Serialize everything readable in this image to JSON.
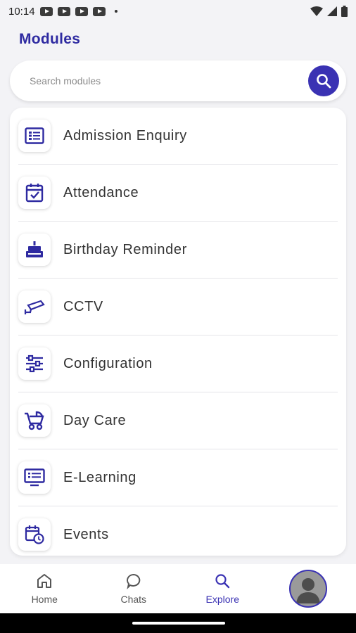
{
  "status_bar": {
    "time": "10:14",
    "notification_icons": [
      "youtube-icon",
      "youtube-icon",
      "youtube-icon",
      "youtube-icon"
    ]
  },
  "page": {
    "title": "Modules"
  },
  "search": {
    "placeholder": "Search modules"
  },
  "modules": [
    {
      "label": "Admission Enquiry",
      "icon": "form-list-icon"
    },
    {
      "label": "Attendance",
      "icon": "calendar-check-icon"
    },
    {
      "label": "Birthday Reminder",
      "icon": "cake-icon"
    },
    {
      "label": "CCTV",
      "icon": "cctv-camera-icon"
    },
    {
      "label": "Configuration",
      "icon": "sliders-icon"
    },
    {
      "label": "Day Care",
      "icon": "stroller-icon"
    },
    {
      "label": "E-Learning",
      "icon": "monitor-icon"
    },
    {
      "label": "Events",
      "icon": "calendar-clock-icon"
    }
  ],
  "bottom_nav": {
    "home": "Home",
    "chats": "Chats",
    "explore": "Explore",
    "active": "explore"
  },
  "colors": {
    "accent": "#3a32b3",
    "title": "#2e2aa1",
    "background": "#f3f3f6"
  }
}
